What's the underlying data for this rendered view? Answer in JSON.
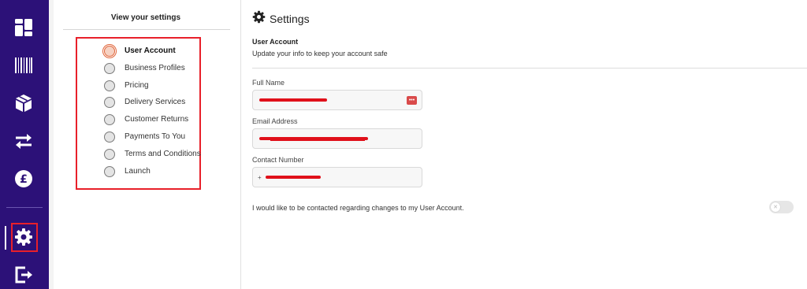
{
  "sidebar": {
    "items": [
      {
        "icon": "dashboard-icon"
      },
      {
        "icon": "barcode-icon"
      },
      {
        "icon": "box-icon"
      },
      {
        "icon": "transfer-arrows-icon"
      },
      {
        "icon": "pound-icon"
      },
      {
        "icon": "gear-icon"
      },
      {
        "icon": "logout-icon"
      }
    ],
    "active": "gear-icon",
    "background": "#2c1178"
  },
  "settings_nav": {
    "title": "View your settings",
    "steps": [
      {
        "label": "User Account",
        "active": true
      },
      {
        "label": "Business Profiles",
        "active": false
      },
      {
        "label": "Pricing",
        "active": false
      },
      {
        "label": "Delivery Services",
        "active": false
      },
      {
        "label": "Customer Returns",
        "active": false
      },
      {
        "label": "Payments To You",
        "active": false
      },
      {
        "label": "Terms and Conditions",
        "active": false
      },
      {
        "label": "Launch",
        "active": false
      }
    ]
  },
  "main": {
    "title": "Settings",
    "section_title": "User Account",
    "section_subtitle": "Update your info to keep your account safe",
    "fields": {
      "full_name_label": "Full Name",
      "email_label": "Email Address",
      "contact_label": "Contact Number",
      "contact_prefix": "+"
    },
    "contact_pref_text": "I would like to be contacted regarding changes to my User Account.",
    "contact_pref_enabled": false
  },
  "colors": {
    "accent": "#2c1178",
    "highlight": "#e8202a",
    "active_step": "#e0653a"
  }
}
